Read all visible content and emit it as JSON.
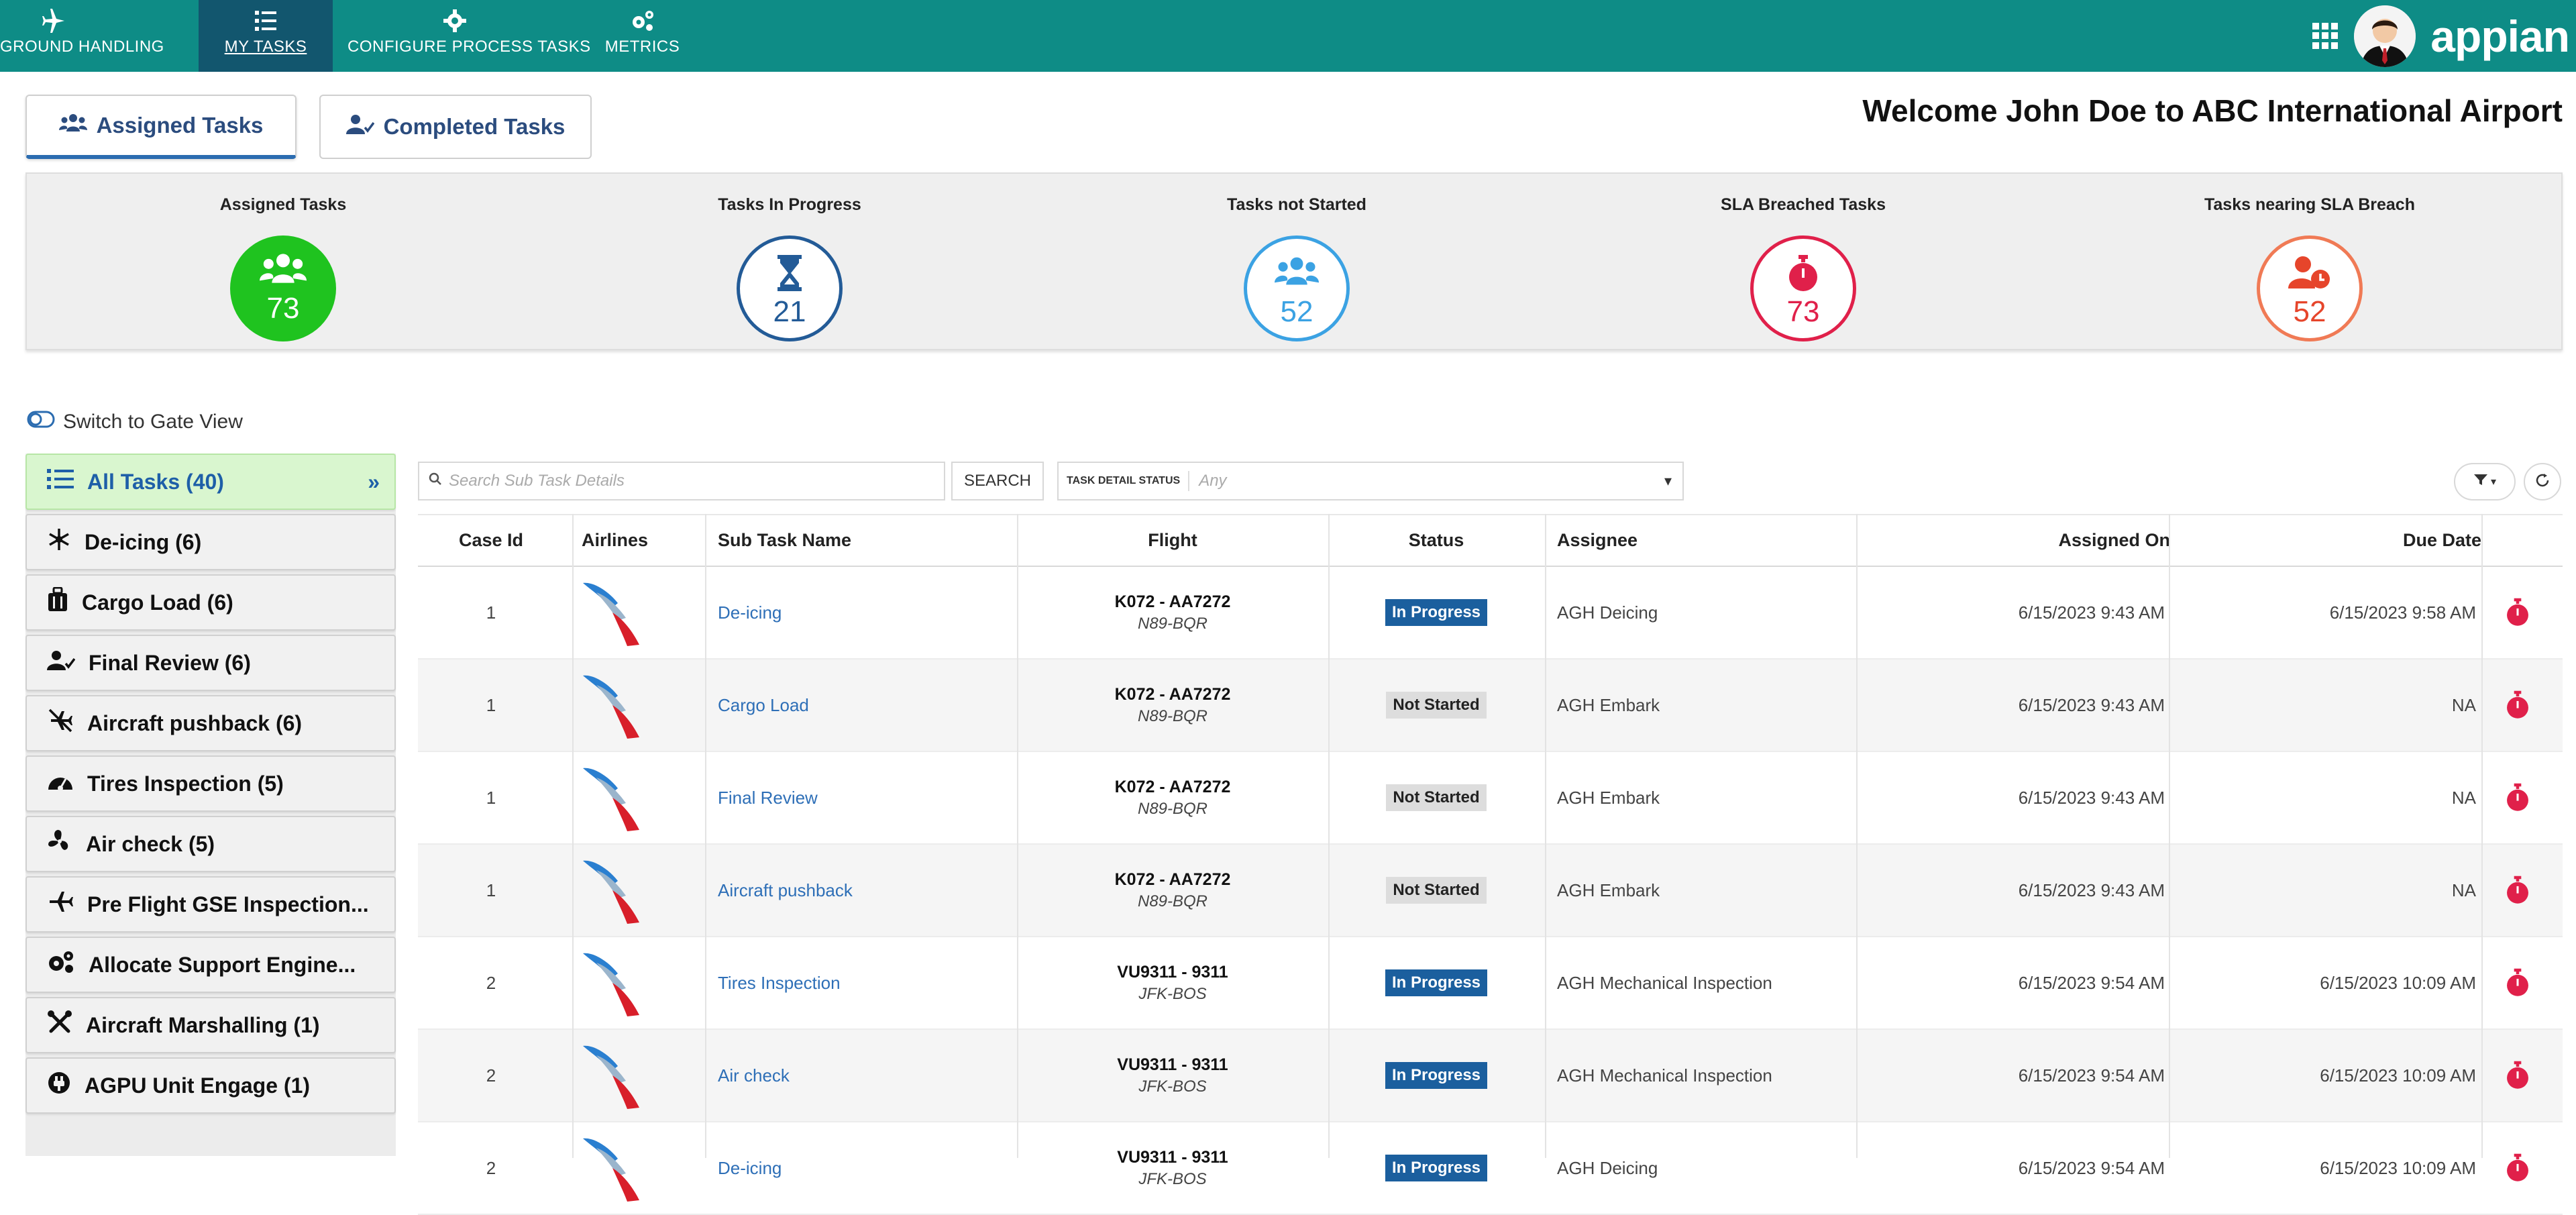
{
  "colors": {
    "nav_bg": "#0e8c86",
    "nav_active": "#12566e",
    "green": "#1fc31f",
    "blue": "#235b97",
    "lightblue": "#3ba2e3",
    "red": "#e0204a",
    "orange": "#f07a55"
  },
  "nav": {
    "items": [
      {
        "label": "GROUND HANDLING",
        "icon": "airplane-icon"
      },
      {
        "label": "MY TASKS",
        "icon": "task-list-icon"
      },
      {
        "label": "CONFIGURE PROCESS TASKS",
        "icon": "gear-icon"
      },
      {
        "label": "METRICS",
        "icon": "gears-icon"
      }
    ],
    "logo": "appian"
  },
  "tabs": {
    "assigned": "Assigned Tasks",
    "completed": "Completed Tasks"
  },
  "welcome": "Welcome John Doe to ABC International Airport",
  "kpis": [
    {
      "title": "Assigned Tasks",
      "value": "73",
      "icon": "users-icon"
    },
    {
      "title": "Tasks In Progress",
      "value": "21",
      "icon": "hourglass-icon"
    },
    {
      "title": "Tasks not Started",
      "value": "52",
      "icon": "users-icon"
    },
    {
      "title": "SLA Breached Tasks",
      "value": "73",
      "icon": "stopwatch-icon"
    },
    {
      "title": "Tasks nearing SLA Breach",
      "value": "52",
      "icon": "user-clock-icon"
    }
  ],
  "switch_label": "Switch to Gate View",
  "categories": [
    {
      "label": "All Tasks (40)",
      "icon": "list-icon"
    },
    {
      "label": "De-icing (6)",
      "icon": "snowflake-icon"
    },
    {
      "label": "Cargo Load (6)",
      "icon": "suitcase-icon"
    },
    {
      "label": "Final Review (6)",
      "icon": "user-check-icon"
    },
    {
      "label": "Aircraft pushback (6)",
      "icon": "plane-slash-icon"
    },
    {
      "label": "Tires Inspection (5)",
      "icon": "gauge-icon"
    },
    {
      "label": "Air check (5)",
      "icon": "fan-icon"
    },
    {
      "label": "Pre Flight GSE Inspection...",
      "icon": "plane-icon"
    },
    {
      "label": "Allocate Support Engine...",
      "icon": "cogs-icon"
    },
    {
      "label": "Aircraft Marshalling (1)",
      "icon": "tools-icon"
    },
    {
      "label": "AGPU Unit Engage (1)",
      "icon": "plug-icon"
    }
  ],
  "search": {
    "placeholder": "Search Sub Task Details",
    "button": "SEARCH"
  },
  "status_filter": {
    "label": "TASK DETAIL STATUS",
    "value": "Any"
  },
  "table": {
    "headers": [
      "Case Id",
      "Airlines",
      "Sub Task Name",
      "Flight",
      "Status",
      "Assignee",
      "Assigned On",
      "Due Date"
    ],
    "rows": [
      {
        "case_id": "1",
        "task": "De-icing",
        "flight": "K072 - AA7272",
        "route": "N89-BQR",
        "status": "In Progress",
        "assignee": "AGH Deicing",
        "assigned_on": "6/15/2023 9:43 AM",
        "due": "6/15/2023 9:58 AM"
      },
      {
        "case_id": "1",
        "task": "Cargo Load",
        "flight": "K072 - AA7272",
        "route": "N89-BQR",
        "status": "Not Started",
        "assignee": "AGH Embark",
        "assigned_on": "6/15/2023 9:43 AM",
        "due": "NA"
      },
      {
        "case_id": "1",
        "task": "Final Review",
        "flight": "K072 - AA7272",
        "route": "N89-BQR",
        "status": "Not Started",
        "assignee": "AGH Embark",
        "assigned_on": "6/15/2023 9:43 AM",
        "due": "NA"
      },
      {
        "case_id": "1",
        "task": "Aircraft pushback",
        "flight": "K072 - AA7272",
        "route": "N89-BQR",
        "status": "Not Started",
        "assignee": "AGH Embark",
        "assigned_on": "6/15/2023 9:43 AM",
        "due": "NA"
      },
      {
        "case_id": "2",
        "task": "Tires Inspection",
        "flight": "VU9311 - 9311",
        "route": "JFK-BOS",
        "status": "In Progress",
        "assignee": "AGH Mechanical Inspection",
        "assigned_on": "6/15/2023 9:54 AM",
        "due": "6/15/2023 10:09 AM"
      },
      {
        "case_id": "2",
        "task": "Air check",
        "flight": "VU9311 - 9311",
        "route": "JFK-BOS",
        "status": "In Progress",
        "assignee": "AGH Mechanical Inspection",
        "assigned_on": "6/15/2023 9:54 AM",
        "due": "6/15/2023 10:09 AM"
      },
      {
        "case_id": "2",
        "task": "De-icing",
        "flight": "VU9311 - 9311",
        "route": "JFK-BOS",
        "status": "In Progress",
        "assignee": "AGH Deicing",
        "assigned_on": "6/15/2023 9:54 AM",
        "due": "6/15/2023 10:09 AM"
      }
    ]
  }
}
